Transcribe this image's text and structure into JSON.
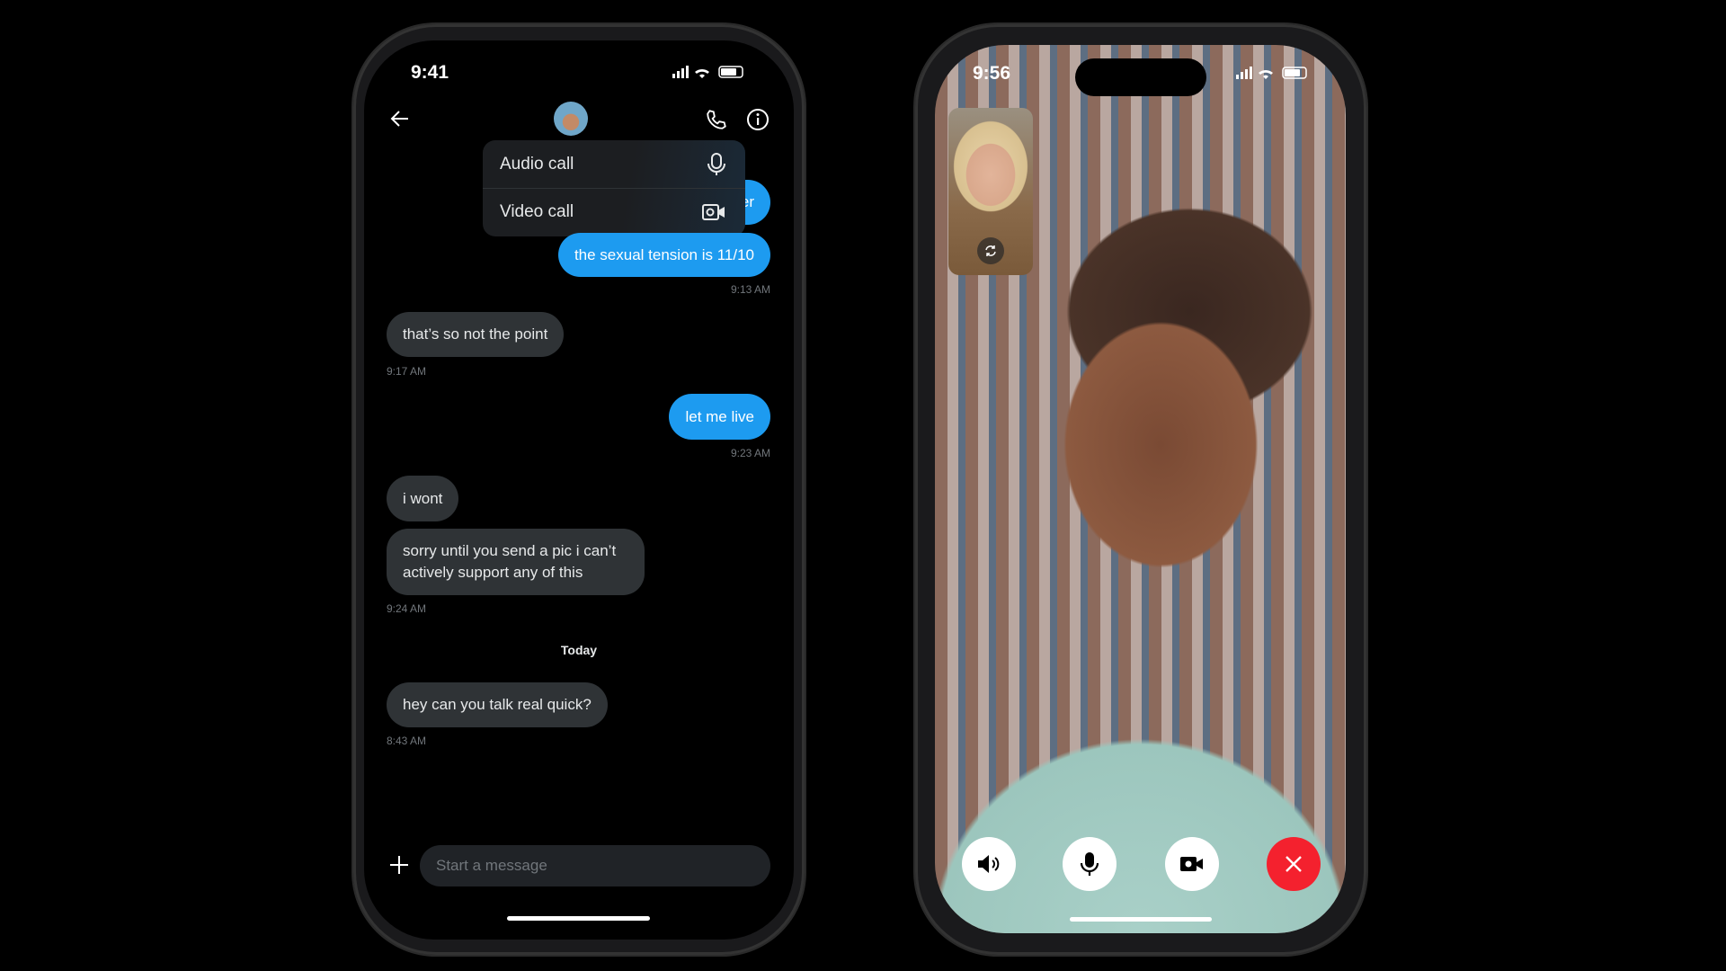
{
  "chat": {
    "status_time": "9:41",
    "menu": [
      {
        "label": "Audio call",
        "icon": "microphone-icon"
      },
      {
        "label": "Video call",
        "icon": "video-camera-icon"
      }
    ],
    "hidden_bubble_fragment": "er",
    "messages": [
      {
        "text": "the sexual tension is 11/10",
        "dir": "out",
        "time": "9:13 AM"
      },
      {
        "text": "that’s so not the point",
        "dir": "in",
        "time": "9:17 AM"
      },
      {
        "text": "let me live",
        "dir": "out",
        "time": "9:23 AM"
      },
      {
        "text": "i wont",
        "dir": "in"
      },
      {
        "text": "sorry until you send a pic i can’t actively support any of this",
        "dir": "in",
        "time": "9:24 AM"
      },
      {
        "text": "hey can you talk real quick?",
        "dir": "in",
        "time": "8:43 AM"
      }
    ],
    "date_divider": "Today",
    "composer_placeholder": "Start a message",
    "colors": {
      "outgoing": "#1d9bf0",
      "incoming": "#2f3336"
    }
  },
  "call": {
    "status_time": "9:56",
    "controls": [
      "speaker-icon",
      "microphone-icon",
      "video-camera-icon",
      "end-call-icon"
    ],
    "colors": {
      "end_call": "#f4212e"
    }
  }
}
